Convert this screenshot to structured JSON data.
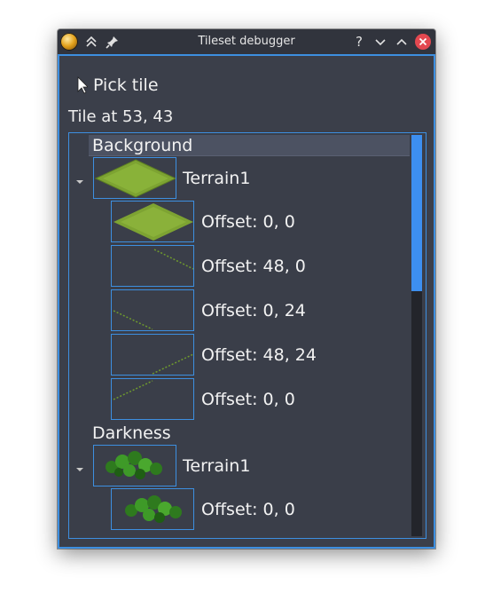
{
  "window": {
    "title": "Tileset debugger"
  },
  "toolbar": {
    "pick_label": "Pick tile"
  },
  "info": {
    "tile_label": "Tile at 53, 43"
  },
  "tree": {
    "groups": [
      {
        "name": "Background",
        "terrain": "Terrain1",
        "offsets": [
          "Offset: 0, 0",
          "Offset: 48, 0",
          "Offset: 0, 24",
          "Offset: 48, 24",
          "Offset: 0, 0"
        ]
      },
      {
        "name": "Darkness",
        "terrain": "Terrain1",
        "offsets": [
          "Offset: 0, 0"
        ]
      }
    ]
  },
  "colors": {
    "accent": "#3d8fe0",
    "background": "#3b3f4a",
    "titlebar": "#31343d",
    "close": "#e34850"
  }
}
